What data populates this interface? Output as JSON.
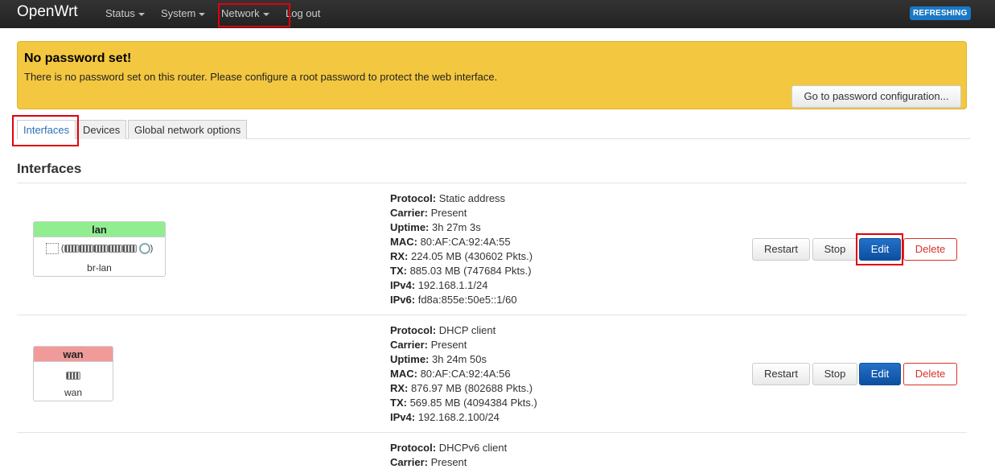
{
  "app": {
    "brand": "OpenWrt",
    "refresh_badge": "REFRESHING"
  },
  "nav": {
    "items": [
      {
        "label": "Status"
      },
      {
        "label": "System"
      },
      {
        "label": "Network"
      },
      {
        "label": "Log out"
      }
    ]
  },
  "alert": {
    "title": "No password set!",
    "message": "There is no password set on this router. Please configure a root password to protect the web interface.",
    "button": "Go to password configuration..."
  },
  "tabs": [
    {
      "label": "Interfaces",
      "active": true
    },
    {
      "label": "Devices"
    },
    {
      "label": "Global network options"
    }
  ],
  "section_title": "Interfaces",
  "interfaces": [
    {
      "name": "lan",
      "device": "br-lan",
      "header_color": "#90ee90",
      "details": [
        {
          "key": "Protocol:",
          "value": "Static address"
        },
        {
          "key": "Carrier:",
          "value": "Present"
        },
        {
          "key": "Uptime:",
          "value": "3h 27m 3s"
        },
        {
          "key": "MAC:",
          "value": "80:AF:CA:92:4A:55"
        },
        {
          "key": "RX:",
          "value": "224.05 MB (430602 Pkts.)"
        },
        {
          "key": "TX:",
          "value": "885.03 MB (747684 Pkts.)"
        },
        {
          "key": "IPv4:",
          "value": "192.168.1.1/24"
        },
        {
          "key": "IPv6:",
          "value": "fd8a:855e:50e5::1/60"
        }
      ]
    },
    {
      "name": "wan",
      "device": "wan",
      "header_color": "#f09a9a",
      "details": [
        {
          "key": "Protocol:",
          "value": "DHCP client"
        },
        {
          "key": "Carrier:",
          "value": "Present"
        },
        {
          "key": "Uptime:",
          "value": "3h 24m 50s"
        },
        {
          "key": "MAC:",
          "value": "80:AF:CA:92:4A:56"
        },
        {
          "key": "RX:",
          "value": "876.97 MB (802688 Pkts.)"
        },
        {
          "key": "TX:",
          "value": "569.85 MB (4094384 Pkts.)"
        },
        {
          "key": "IPv4:",
          "value": "192.168.2.100/24"
        }
      ]
    },
    {
      "details": [
        {
          "key": "Protocol:",
          "value": "DHCPv6 client"
        },
        {
          "key": "Carrier:",
          "value": "Present"
        }
      ]
    }
  ],
  "actions": {
    "restart": "Restart",
    "stop": "Stop",
    "edit": "Edit",
    "delete": "Delete"
  },
  "colors": {
    "navbar": "#222222",
    "alert": "#f3c840",
    "primary": "#1259b4",
    "danger": "#d9322a",
    "highlight": "#e0000c"
  }
}
